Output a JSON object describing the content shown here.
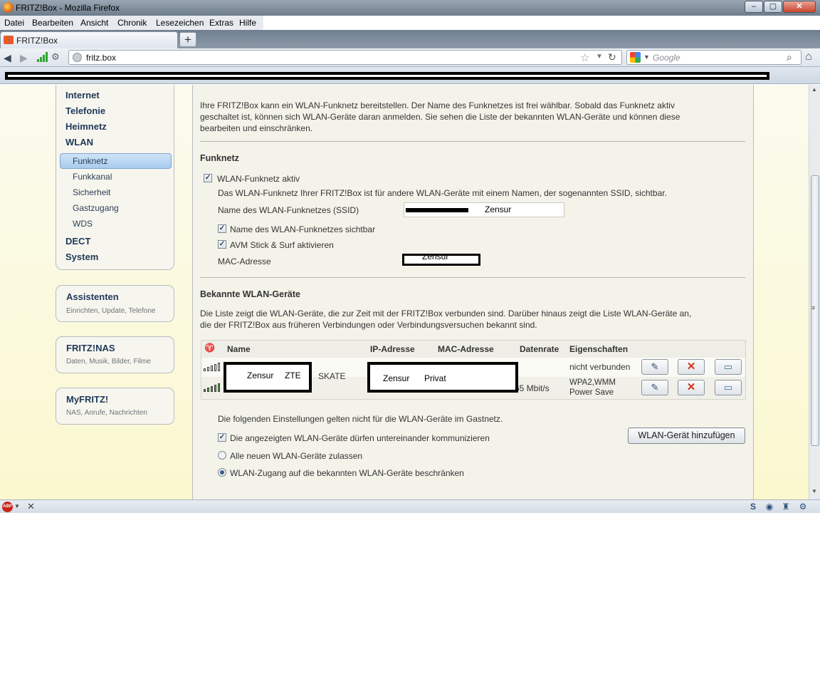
{
  "window": {
    "title": "FRITZ!Box - Mozilla Firefox",
    "min": "–",
    "max": "▢",
    "close": "✕"
  },
  "menu": [
    "Datei",
    "Bearbeiten",
    "Ansicht",
    "Chronik",
    "Lesezeichen",
    "Extras",
    "Hilfe"
  ],
  "tab": {
    "label": "FRITZ!Box",
    "new_tab": "+"
  },
  "nav": {
    "url": "fritz.box",
    "search_placeholder": "Google"
  },
  "icons": {
    "back": "arrow-left-icon",
    "forward": "arrow-right-icon",
    "reload": "reload-icon",
    "home": "home-icon",
    "bookmark": "star-icon",
    "search": "magnifier-icon"
  },
  "sidebar": {
    "main": [
      {
        "label": "Internet"
      },
      {
        "label": "Telefonie"
      },
      {
        "label": "Heimnetz"
      },
      {
        "label": "WLAN"
      },
      {
        "label": "DECT"
      },
      {
        "label": "System"
      }
    ],
    "wlan_sub": [
      {
        "label": "Funknetz",
        "selected": true
      },
      {
        "label": "Funkkanal"
      },
      {
        "label": "Sicherheit"
      },
      {
        "label": "Gastzugang"
      },
      {
        "label": "WDS"
      }
    ],
    "boxes": [
      {
        "title": "Assistenten",
        "sub": "Einrichten, Update, Telefone"
      },
      {
        "title": "FRITZ!NAS",
        "sub": "Daten, Musik, Bilder, Filme"
      },
      {
        "title": "MyFRITZ!",
        "sub": "NAS, Anrufe, Nachrichten"
      }
    ]
  },
  "main": {
    "intro_1": "Ihre FRITZ!Box kann ein WLAN-Funknetz bereitstellen. Der Name des Funknetzes ist frei wählbar. Sobald das Funknetz aktiv",
    "intro_2": "geschaltet ist, können sich WLAN-Geräte daran anmelden. Sie sehen die Liste der bekannten WLAN-Geräte und können diese",
    "intro_3": "bearbeiten und einschränken.",
    "funknetz_heading": "Funknetz",
    "wlan_active": {
      "label": "WLAN-Funknetz aktiv",
      "checked": true
    },
    "ssid_desc": "Das WLAN-Funknetz Ihrer FRITZ!Box ist für andere WLAN-Geräte mit einem Namen, der sogenannten SSID, sichtbar.",
    "ssid_label": "Name des WLAN-Funknetzes (SSID)",
    "ssid_value": "Zensur",
    "ssid_visible": {
      "label": "Name des WLAN-Funknetzes sichtbar",
      "checked": true
    },
    "avm_stick": {
      "label": "AVM Stick & Surf aktivieren",
      "checked": true
    },
    "mac_label": "MAC-Adresse",
    "mac_value": "Zensur",
    "known_heading": "Bekannte WLAN-Geräte",
    "known_desc_1": "Die Liste zeigt die WLAN-Geräte, die zur Zeit mit der FRITZ!Box verbunden sind. Darüber hinaus zeigt die Liste WLAN-Geräte an,",
    "known_desc_2": "die der FRITZ!Box aus früheren Verbindungen oder Verbindungsversuchen bekannt sind.",
    "table": {
      "headers": {
        "name": "Name",
        "ip": "IP-Adresse",
        "mac": "MAC-Adresse",
        "rate": "Datenrate",
        "props": "Eigenschaften"
      },
      "rows": [
        {
          "props": "nicht verbunden",
          "signal": 0.0
        },
        {
          "name_extra": "SKATE",
          "rate": "65 Mbit/s",
          "props_1": "WPA2,WMM",
          "props_2": "Power Save",
          "signal": 1.0
        }
      ],
      "redacted_name": {
        "a": "Zensur",
        "b": "ZTE"
      },
      "redacted_ipmac": {
        "a": "Zensur",
        "b": "Privat"
      },
      "actions": {
        "edit": "✎",
        "delete": "✕",
        "message": "▭"
      }
    },
    "guest_note": "Die folgenden Einstellungen gelten nicht für die WLAN-Geräte im Gastnetz.",
    "allow_intercomm": {
      "label": "Die angezeigten WLAN-Geräte dürfen untereinander kommunizieren",
      "checked": true
    },
    "allow_all": {
      "label": "Alle neuen WLAN-Geräte zulassen",
      "selected": false
    },
    "restrict": {
      "label": "WLAN-Zugang auf die bekannten WLAN-Geräte beschränken",
      "selected": true
    },
    "add_button": "WLAN-Gerät hinzufügen"
  },
  "statusbar": {
    "close": "✕",
    "abp": "ABP"
  }
}
